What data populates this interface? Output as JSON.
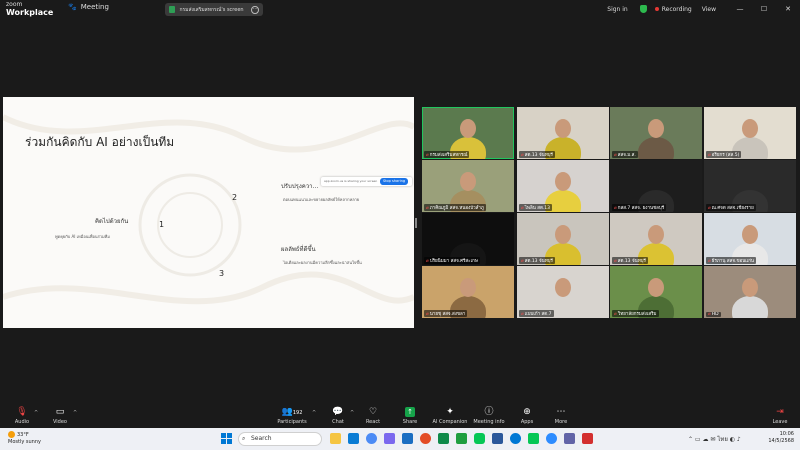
{
  "app": {
    "brand_top": "zoom",
    "brand_bottom": "Workplace",
    "meeting_label": "Meeting",
    "share_pill_text": "กรมส่งเสริมสหกรณ์'s screen",
    "signin": "Sign in",
    "recording": "Recording",
    "view": "View"
  },
  "slide": {
    "title": "ร่วมกันคิดกับ AI อย่างเป็นทีม",
    "share_bar_text": "app.zoom.us is sharing your screen",
    "stop_sharing": "Stop sharing",
    "item1_title": "คิดไปด้วยกัน",
    "item1_sub": "พูดคุยกับ AI เหมือนเพื่อนร่วมทีม",
    "item2_title": "ปรับปรุงควา...",
    "item2_sub": "ตอบแทนแนวและขยายผลลัพธ์ให้หลากหลาย",
    "item3_title": "ผลลัพธ์ที่ดีขึ้น",
    "item3_sub": "ไอเดียและผลงานมีความลึกซึ้งและน่าสนใจขึ้น",
    "num1": "1",
    "num2": "2",
    "num3": "3"
  },
  "participants": [
    {
      "name": "กรมส่งเสริมสหกรณ์",
      "bg": "#5b7a4e",
      "shirt": "#d9c13a",
      "active": true
    },
    {
      "name": "สต.13 จันทบุรี",
      "bg": "#d8d2c6",
      "shirt": "#c9b22a"
    },
    {
      "name": "สสจ.ม.ส.",
      "bg": "#6a7b5a",
      "shirt": "#6c5a46"
    },
    {
      "name": "อริยกร (สส.5)",
      "bg": "#e3ddd0",
      "shirt": "#c9c4bb"
    },
    {
      "name": "ภาคิณภูมิ สสจ.หนองบัวลำภู",
      "bg": "#9aa07a",
      "shirt": "#a58f60"
    },
    {
      "name": "ไพลิน สต.13",
      "bg": "#d6d2cf",
      "shirt": "#e7cf3f"
    },
    {
      "name": "กสส.7 สสจ. ยงานชลบุรี",
      "bg": "#1d1d1d",
      "shirt": "#2a2a2a"
    },
    {
      "name": "ณ.ศจต สสจ.เชียงราย",
      "bg": "#2a2a2a",
      "shirt": "#333"
    },
    {
      "name": "ปริยนิมมา สสจ.ศรีสะเกษ",
      "bg": "#0e0e0e",
      "shirt": "#151515"
    },
    {
      "name": "สต.13 จันทบุรี",
      "bg": "#c9c5bd",
      "shirt": "#d9bf2f"
    },
    {
      "name": "สต.13 จันทบุรี",
      "bg": "#cfc9c1",
      "shirt": "#dbc233"
    },
    {
      "name": "ธีรภานุ สสจ.ขอนแก่น",
      "bg": "#d7dde3",
      "shirt": "#e8e8e8"
    },
    {
      "name": "นายชุ สสจ.สงขลา",
      "bg": "#caa36a",
      "shirt": "#8c6a42"
    },
    {
      "name": "แบบเก้า สต.7",
      "bg": "#d8d4cf",
      "shirt": "#d8d4cf"
    },
    {
      "name": "วิทยาลัยกรมส่งเสริม",
      "bg": "#6b8f4a",
      "shirt": "#4d6e35"
    },
    {
      "name": "HD",
      "bg": "#9c8c7c",
      "shirt": "#d8d8d8"
    }
  ],
  "toolbar": {
    "audio": "Audio",
    "video": "Video",
    "participants": "Participants",
    "participants_count": "192",
    "chat": "Chat",
    "react": "React",
    "share": "Share",
    "ai_companion": "AI Companion",
    "meeting_info": "Meeting info",
    "apps": "Apps",
    "more": "More",
    "leave": "Leave"
  },
  "taskbar": {
    "weather_temp": "33°F",
    "weather_desc": "Mostly sunny",
    "search": "Search",
    "lang": "ไทย",
    "time": "10:06",
    "date": "14/5/2568"
  },
  "colors": {
    "active_speaker": "#22c55e",
    "share_green": "#16a34a",
    "leave_red": "#ef4444",
    "stop_blue": "#1a73e8"
  }
}
